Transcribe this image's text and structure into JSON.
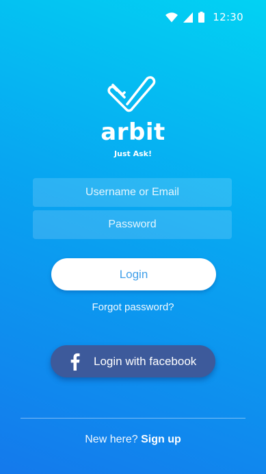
{
  "status_bar": {
    "time": "12:30",
    "icons": [
      "wifi-icon",
      "cellular-signal-icon",
      "battery-icon"
    ]
  },
  "brand": {
    "logo_icon": "checkmark-logo-icon",
    "name": "arbit",
    "tagline": "Just Ask!"
  },
  "form": {
    "username_placeholder": "Username or Email",
    "password_placeholder": "Password",
    "login_label": "Login",
    "forgot_label": "Forgot password?"
  },
  "facebook": {
    "icon": "facebook-icon",
    "label": "Login with facebook"
  },
  "footer": {
    "prompt": "New here?",
    "signup_label": "Sign up"
  },
  "colors": {
    "gradient_top": "#02d2f3",
    "gradient_bottom": "#1479ec",
    "facebook_blue": "#3d5a9b",
    "login_text": "#3f9fe9"
  }
}
